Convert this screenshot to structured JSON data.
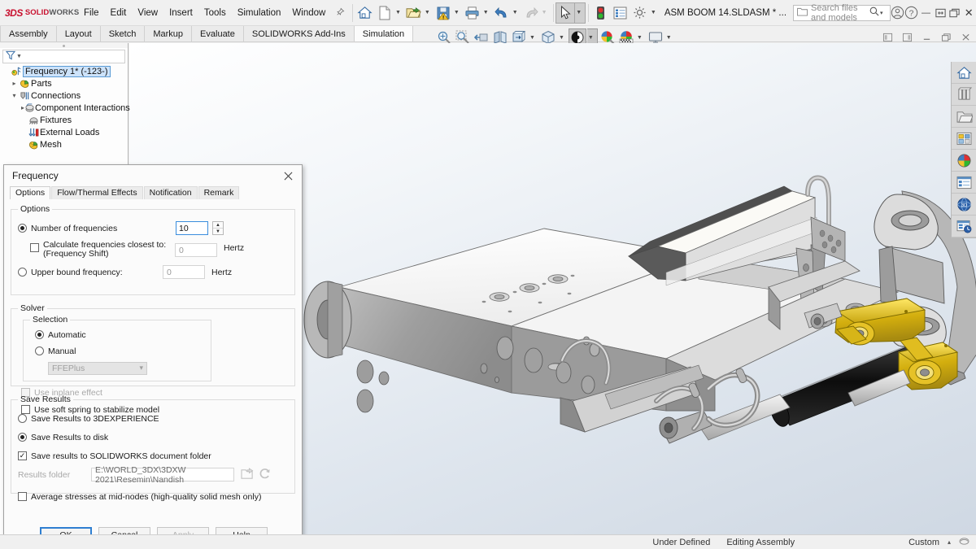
{
  "app": {
    "brand_ds": "3DS",
    "brand_solid": "SOLID",
    "brand_works": "WORKS",
    "document_title": "ASM BOOM 14.SLDASM * ..."
  },
  "menu": {
    "items": [
      {
        "label": "File"
      },
      {
        "label": "Edit"
      },
      {
        "label": "View"
      },
      {
        "label": "Insert"
      },
      {
        "label": "Tools"
      },
      {
        "label": "Simulation"
      },
      {
        "label": "Window"
      }
    ],
    "pin_icon": "pushpin-icon"
  },
  "toolbar": {
    "buttons": [
      {
        "name": "home-button",
        "icon": "home-icon",
        "has_caret": false
      },
      {
        "name": "new-document-button",
        "icon": "new-document-icon",
        "has_caret": true
      },
      {
        "name": "open-button",
        "icon": "open-folder-icon",
        "has_caret": true
      },
      {
        "name": "save-button",
        "icon": "save-warning-icon",
        "has_caret": true
      },
      {
        "name": "print-button",
        "icon": "printer-icon",
        "has_caret": true
      },
      {
        "name": "undo-button",
        "icon": "undo-arrow-icon",
        "has_caret": true
      },
      {
        "name": "redo-button",
        "icon": "redo-arrow-icon",
        "has_caret": true
      },
      {
        "name": "select-button",
        "icon": "cursor-arrow-icon",
        "has_caret": true
      },
      {
        "name": "rebuild-status-button",
        "icon": "traffic-light-icon",
        "has_caret": false
      },
      {
        "name": "options-list-button",
        "icon": "list-panel-icon",
        "has_caret": false
      },
      {
        "name": "settings-button",
        "icon": "gear-icon",
        "has_caret": true
      }
    ]
  },
  "search": {
    "placeholder": "Search files and models",
    "icon": "search-icon",
    "folder_icon": "folder-icon",
    "caret": "▾"
  },
  "window": {
    "account_icon": "user-account-icon",
    "help_icon": "help-question-icon",
    "minimize": "—",
    "restore_icon": "restore-window-icon",
    "maximize_icon": "maximize-window-icon",
    "close": "✕"
  },
  "command_tabs": [
    {
      "label": "Assembly",
      "active": false
    },
    {
      "label": "Layout",
      "active": false
    },
    {
      "label": "Sketch",
      "active": false
    },
    {
      "label": "Markup",
      "active": false
    },
    {
      "label": "Evaluate",
      "active": false
    },
    {
      "label": "SOLIDWORKS Add-Ins",
      "active": false
    },
    {
      "label": "Simulation",
      "active": true
    }
  ],
  "view_toolbar": {
    "buttons": [
      {
        "name": "zoom-to-fit-button",
        "icon": "zoom-fit-icon",
        "has_caret": false,
        "selected": false
      },
      {
        "name": "zoom-to-area-button",
        "icon": "zoom-area-icon",
        "has_caret": false,
        "selected": false
      },
      {
        "name": "previous-view-button",
        "icon": "previous-view-icon",
        "has_caret": false,
        "selected": false
      },
      {
        "name": "section-view-button",
        "icon": "section-view-icon",
        "has_caret": false,
        "selected": false
      },
      {
        "name": "view-orientation-button",
        "icon": "view-orientation-icon",
        "has_caret": true,
        "selected": false
      },
      {
        "name": "display-style-button",
        "icon": "display-style-cube-icon",
        "has_caret": true,
        "selected": false
      },
      {
        "name": "hide-show-items-button",
        "icon": "hide-show-eye-icon",
        "has_caret": true,
        "selected": true
      },
      {
        "name": "edit-appearance-button",
        "icon": "appearance-sphere-icon",
        "has_caret": false,
        "selected": false
      },
      {
        "name": "apply-scene-button",
        "icon": "scene-sphere-icon",
        "has_caret": true,
        "selected": false
      },
      {
        "name": "view-settings-button",
        "icon": "monitor-icon",
        "has_caret": true,
        "selected": false
      }
    ]
  },
  "window_view_controls": [
    {
      "name": "tile-left-button",
      "icon": "tile-left-icon"
    },
    {
      "name": "tile-right-button",
      "icon": "tile-right-icon"
    },
    {
      "name": "doc-minimize-button",
      "icon": "minimize-icon"
    },
    {
      "name": "doc-restore-button",
      "icon": "restore-icon"
    },
    {
      "name": "doc-close-button",
      "icon": "close-icon"
    }
  ],
  "feature_tree": {
    "filter": {
      "icon": "filter-funnel-icon",
      "value": "",
      "placeholder": ""
    },
    "items": [
      {
        "label": "Frequency 1* (-123-)",
        "icon": "study-frequency-icon",
        "indent": 0,
        "expander": "",
        "selected": true
      },
      {
        "label": "Parts",
        "icon": "parts-folder-icon",
        "indent": 1,
        "expander": "▸",
        "selected": false
      },
      {
        "label": "Connections",
        "icon": "connections-icon",
        "indent": 1,
        "expander": "▾",
        "selected": false
      },
      {
        "label": "Component Interactions",
        "icon": "component-interactions-icon",
        "indent": 2,
        "expander": "▸",
        "selected": false
      },
      {
        "label": "Fixtures",
        "icon": "fixtures-icon",
        "indent": 1,
        "expander": "",
        "selected": false
      },
      {
        "label": "External Loads",
        "icon": "external-loads-icon",
        "indent": 1,
        "expander": "",
        "selected": false
      },
      {
        "label": "Mesh",
        "icon": "mesh-icon",
        "indent": 1,
        "expander": "",
        "selected": false
      }
    ]
  },
  "right_toolbar": [
    {
      "name": "task-pane-home-button",
      "icon": "home-icon"
    },
    {
      "name": "design-library-button",
      "icon": "design-library-icon"
    },
    {
      "name": "file-explorer-button",
      "icon": "file-explorer-folder-icon"
    },
    {
      "name": "view-palette-button",
      "icon": "view-palette-icon"
    },
    {
      "name": "appearances-scenes-button",
      "icon": "appearances-sphere-icon"
    },
    {
      "name": "custom-properties-button",
      "icon": "custom-properties-icon"
    },
    {
      "name": "3dexperience-marketplace-button",
      "icon": "3dexperience-globe-icon"
    },
    {
      "name": "simulation-tools-button",
      "icon": "simulation-tools-icon"
    }
  ],
  "dialog": {
    "title": "Frequency",
    "close_icon": "close-icon",
    "tabs": [
      {
        "label": "Options",
        "active": true
      },
      {
        "label": "Flow/Thermal Effects",
        "active": false
      },
      {
        "label": "Notification",
        "active": false
      },
      {
        "label": "Remark",
        "active": false
      }
    ],
    "options_group": {
      "legend": "Options",
      "number_of_frequencies": {
        "label": "Number of frequencies",
        "selected": true,
        "value": "10"
      },
      "frequency_shift": {
        "label_line1": "Calculate frequencies closest to:",
        "label_line2": "(Frequency Shift)",
        "checked": false,
        "value": "0",
        "unit": "Hertz"
      },
      "upper_bound": {
        "label": "Upper bound frequency:",
        "selected": false,
        "value": "0",
        "unit": "Hertz"
      }
    },
    "solver_group": {
      "legend": "Solver",
      "selection_legend": "Selection",
      "automatic": {
        "label": "Automatic",
        "selected": true
      },
      "manual": {
        "label": "Manual",
        "selected": false
      },
      "solver_combo": {
        "value": "FFEPlus",
        "caret": "⌄",
        "disabled": true
      },
      "inplane_effect": {
        "label": "Use inplane effect",
        "checked": false,
        "disabled": true
      },
      "soft_spring": {
        "label": "Use soft spring to stabilize model",
        "checked": false,
        "disabled": false
      }
    },
    "save_results_group": {
      "legend": "Save Results",
      "save_3dexperience": {
        "label": "Save Results to 3DEXPERIENCE",
        "selected": false
      },
      "save_disk": {
        "label": "Save Results to disk",
        "selected": true
      },
      "save_swfolder": {
        "label": "Save results to SOLIDWORKS document folder",
        "checked": true
      },
      "results_folder": {
        "label": "Results folder",
        "value": "E:\\WORLD_3DX\\3DXW 2021\\Resemin\\Nandish",
        "browse_icon": "browse-folder-icon",
        "refresh_icon": "refresh-icon"
      },
      "average_stresses": {
        "label": "Average stresses at mid-nodes (high-quality solid mesh only)",
        "checked": false
      }
    },
    "buttons": [
      {
        "label": "OK",
        "name": "ok-button",
        "style": "default"
      },
      {
        "label": "Cancel",
        "name": "cancel-button",
        "style": "normal"
      },
      {
        "label": "Apply",
        "name": "apply-button",
        "style": "disabled"
      },
      {
        "label": "Help",
        "name": "help-button",
        "style": "normal"
      }
    ]
  },
  "status_bar": {
    "under_defined": "Under Defined",
    "editing": "Editing Assembly",
    "units": "Custom",
    "units_caret": "▴",
    "overlay_icon": "overlay-icon"
  },
  "colors": {
    "brand_red": "#c8102e",
    "accent_blue": "#2f7fd1",
    "selection_blue": "#cde3fa",
    "model_yellow": "#d4b21a",
    "model_gray": "#9a9a9a"
  }
}
